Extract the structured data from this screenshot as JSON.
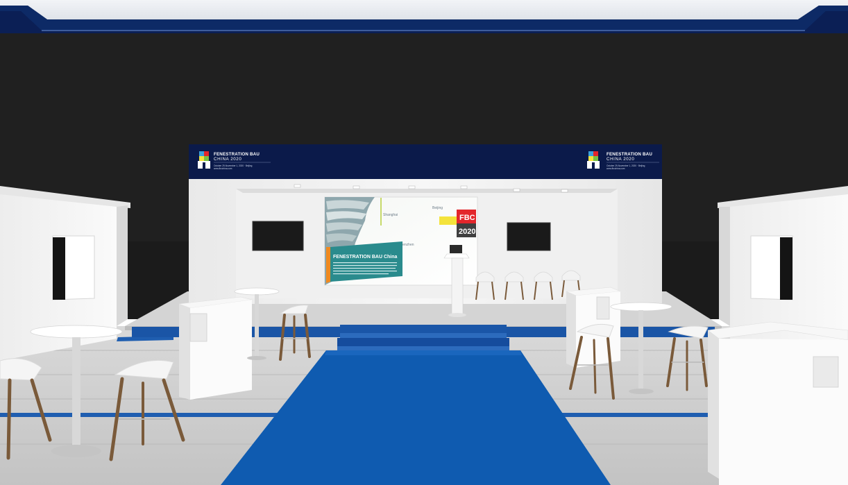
{
  "scene": {
    "kind": "3D rendering of an exhibition stage",
    "colors": {
      "back_wall": "#1a1a1a",
      "ceiling_blue": "#0d2a66",
      "carpet_blue": "#0f5bb0",
      "floor_grey": "#cdcdcd",
      "banner_navy": "#0b1a4a",
      "fbc_red": "#e3262b",
      "fbc_grey": "#3f3f3f",
      "accent_yellow": "#f4e33b"
    }
  },
  "banner_left": {
    "title": "FENESTRATION BAU",
    "subtitle": "CHINA 2020",
    "dates": "October 29-November 1, 2020 · Beijing",
    "url": "www.fbcchina.com"
  },
  "banner_right": {
    "title": "FENESTRATION BAU",
    "subtitle": "CHINA 2020",
    "dates": "October 29-November 1, 2020 · Beijing",
    "url": "www.fbcchina.com"
  },
  "screen": {
    "headline": "FENESTRATION BAU China",
    "fbc_label": "FBC",
    "year_label": "2020",
    "small_labels": [
      "Shanghai",
      "Beijing",
      "Shenzhen"
    ]
  }
}
